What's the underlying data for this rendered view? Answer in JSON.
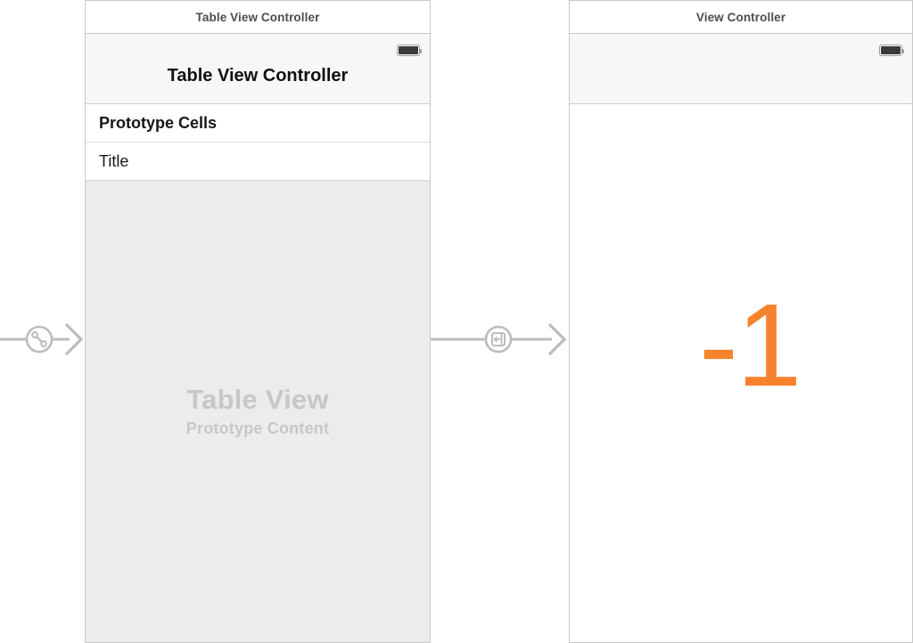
{
  "canvas": {
    "background_color": "#ffffff",
    "connector_color": "#bcbcbc"
  },
  "scenes": [
    {
      "id": "table-view-controller",
      "titlebar_label": "Table View Controller",
      "navbar": {
        "title": "Table View Controller",
        "battery_icon": "battery-icon"
      },
      "cells": [
        {
          "label": "Prototype Cells",
          "style": "header"
        },
        {
          "label": "Title",
          "style": "cell"
        }
      ],
      "placeholder": {
        "main": "Table View",
        "sub": "Prototype Content"
      }
    },
    {
      "id": "view-controller",
      "titlebar_label": "View Controller",
      "navbar": {
        "title": "",
        "battery_icon": "battery-icon"
      },
      "content_label": "-1"
    }
  ],
  "connectors": [
    {
      "id": "entry-point-relationship",
      "icon": "relationship-segue-icon",
      "arrowhead": "chevron-arrow-icon"
    },
    {
      "id": "show-segue",
      "icon": "show-segue-icon",
      "arrowhead": "chevron-arrow-icon"
    }
  ]
}
